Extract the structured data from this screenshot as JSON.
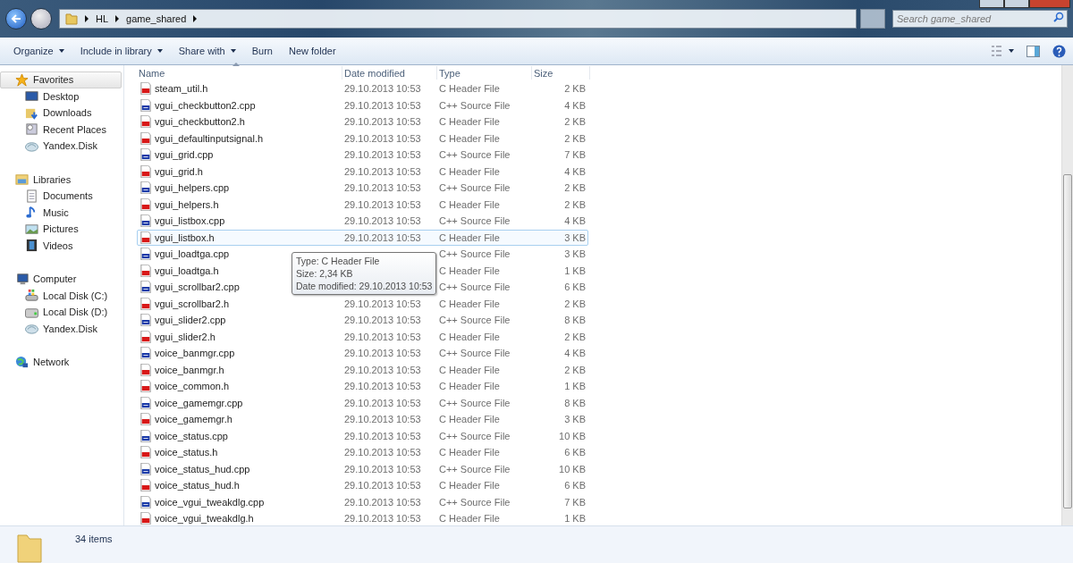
{
  "address_bar": {
    "breadcrumbs": [
      "HL",
      "game_shared"
    ]
  },
  "search": {
    "placeholder": "Search game_shared"
  },
  "toolbar": {
    "buttons": [
      {
        "label": "Organize",
        "dropdown": true
      },
      {
        "label": "Include in library",
        "dropdown": true
      },
      {
        "label": "Share with",
        "dropdown": true
      },
      {
        "label": "Burn",
        "dropdown": false
      },
      {
        "label": "New folder",
        "dropdown": false
      }
    ]
  },
  "sidebar": {
    "groups": [
      {
        "label": "Favorites",
        "kind": "favorites",
        "selected": true,
        "children": [
          {
            "label": "Desktop",
            "kind": "desktop",
            "selected": false
          },
          {
            "label": "Downloads",
            "kind": "downloads",
            "selected": false
          },
          {
            "label": "Recent Places",
            "kind": "recent",
            "selected": false
          },
          {
            "label": "Yandex.Disk",
            "kind": "cloud",
            "selected": false
          }
        ]
      },
      {
        "label": "Libraries",
        "kind": "libraries",
        "selected": false,
        "children": [
          {
            "label": "Documents",
            "kind": "documents",
            "selected": false
          },
          {
            "label": "Music",
            "kind": "music",
            "selected": false
          },
          {
            "label": "Pictures",
            "kind": "pictures",
            "selected": false
          },
          {
            "label": "Videos",
            "kind": "videos",
            "selected": false
          }
        ]
      },
      {
        "label": "Computer",
        "kind": "computer",
        "selected": false,
        "children": [
          {
            "label": "Local Disk (C:)",
            "kind": "system-disk",
            "selected": false
          },
          {
            "label": "Local Disk (D:)",
            "kind": "disk",
            "selected": false
          },
          {
            "label": "Yandex.Disk",
            "kind": "cloud",
            "selected": false
          }
        ]
      },
      {
        "label": "Network",
        "kind": "network",
        "selected": false
      }
    ]
  },
  "table": {
    "columns": [
      "Name",
      "Date modified",
      "Type",
      "Size"
    ],
    "rows": [
      {
        "name": "steam_util.h",
        "date": "29.10.2013 10:53",
        "type": "C Header File",
        "size": "2 KB",
        "kind": "header",
        "selected": false
      },
      {
        "name": "vgui_checkbutton2.cpp",
        "date": "29.10.2013 10:53",
        "type": "C++ Source File",
        "size": "4 KB",
        "kind": "source",
        "selected": false
      },
      {
        "name": "vgui_checkbutton2.h",
        "date": "29.10.2013 10:53",
        "type": "C Header File",
        "size": "2 KB",
        "kind": "header",
        "selected": false
      },
      {
        "name": "vgui_defaultinputsignal.h",
        "date": "29.10.2013 10:53",
        "type": "C Header File",
        "size": "2 KB",
        "kind": "header",
        "selected": false
      },
      {
        "name": "vgui_grid.cpp",
        "date": "29.10.2013 10:53",
        "type": "C++ Source File",
        "size": "7 KB",
        "kind": "source",
        "selected": false
      },
      {
        "name": "vgui_grid.h",
        "date": "29.10.2013 10:53",
        "type": "C Header File",
        "size": "4 KB",
        "kind": "header",
        "selected": false
      },
      {
        "name": "vgui_helpers.cpp",
        "date": "29.10.2013 10:53",
        "type": "C++ Source File",
        "size": "2 KB",
        "kind": "source",
        "selected": false
      },
      {
        "name": "vgui_helpers.h",
        "date": "29.10.2013 10:53",
        "type": "C Header File",
        "size": "2 KB",
        "kind": "header",
        "selected": false
      },
      {
        "name": "vgui_listbox.cpp",
        "date": "29.10.2013 10:53",
        "type": "C++ Source File",
        "size": "4 KB",
        "kind": "source",
        "selected": false
      },
      {
        "name": "vgui_listbox.h",
        "date": "29.10.2013 10:53",
        "type": "C Header File",
        "size": "3 KB",
        "kind": "header",
        "selected": true
      },
      {
        "name": "vgui_loadtga.cpp",
        "type": "C++ Source File",
        "size": "3 KB",
        "kind": "source",
        "selected": false
      },
      {
        "name": "vgui_loadtga.h",
        "type": "C Header File",
        "size": "1 KB",
        "kind": "header",
        "selected": false
      },
      {
        "name": "vgui_scrollbar2.cpp",
        "type": "C++ Source File",
        "size": "6 KB",
        "kind": "source",
        "selected": false
      },
      {
        "name": "vgui_scrollbar2.h",
        "date": "29.10.2013 10:53",
        "type": "C Header File",
        "size": "2 KB",
        "kind": "header",
        "selected": false
      },
      {
        "name": "vgui_slider2.cpp",
        "date": "29.10.2013 10:53",
        "type": "C++ Source File",
        "size": "8 KB",
        "kind": "source",
        "selected": false
      },
      {
        "name": "vgui_slider2.h",
        "date": "29.10.2013 10:53",
        "type": "C Header File",
        "size": "2 KB",
        "kind": "header",
        "selected": false
      },
      {
        "name": "voice_banmgr.cpp",
        "date": "29.10.2013 10:53",
        "type": "C++ Source File",
        "size": "4 KB",
        "kind": "source",
        "selected": false
      },
      {
        "name": "voice_banmgr.h",
        "date": "29.10.2013 10:53",
        "type": "C Header File",
        "size": "2 KB",
        "kind": "header",
        "selected": false
      },
      {
        "name": "voice_common.h",
        "date": "29.10.2013 10:53",
        "type": "C Header File",
        "size": "1 KB",
        "kind": "header",
        "selected": false
      },
      {
        "name": "voice_gamemgr.cpp",
        "date": "29.10.2013 10:53",
        "type": "C++ Source File",
        "size": "8 KB",
        "kind": "source",
        "selected": false
      },
      {
        "name": "voice_gamemgr.h",
        "date": "29.10.2013 10:53",
        "type": "C Header File",
        "size": "3 KB",
        "kind": "header",
        "selected": false
      },
      {
        "name": "voice_status.cpp",
        "date": "29.10.2013 10:53",
        "type": "C++ Source File",
        "size": "10 KB",
        "kind": "source",
        "selected": false
      },
      {
        "name": "voice_status.h",
        "date": "29.10.2013 10:53",
        "type": "C Header File",
        "size": "6 KB",
        "kind": "header",
        "selected": false
      },
      {
        "name": "voice_status_hud.cpp",
        "date": "29.10.2013 10:53",
        "type": "C++ Source File",
        "size": "10 KB",
        "kind": "source",
        "selected": false
      },
      {
        "name": "voice_status_hud.h",
        "date": "29.10.2013 10:53",
        "type": "C Header File",
        "size": "6 KB",
        "kind": "header",
        "selected": false
      },
      {
        "name": "voice_vgui_tweakdlg.cpp",
        "date": "29.10.2013 10:53",
        "type": "C++ Source File",
        "size": "7 KB",
        "kind": "source",
        "selected": false
      },
      {
        "name": "voice_vgui_tweakdlg.h",
        "date": "29.10.2013 10:53",
        "type": "C Header File",
        "size": "1 KB",
        "kind": "header",
        "selected": false
      }
    ]
  },
  "tooltip": {
    "lines": [
      "Type: C Header File",
      "Size: 2,34 KB",
      "Date modified: 29.10.2013 10:53"
    ]
  },
  "status_bar": {
    "text": "34 items"
  }
}
